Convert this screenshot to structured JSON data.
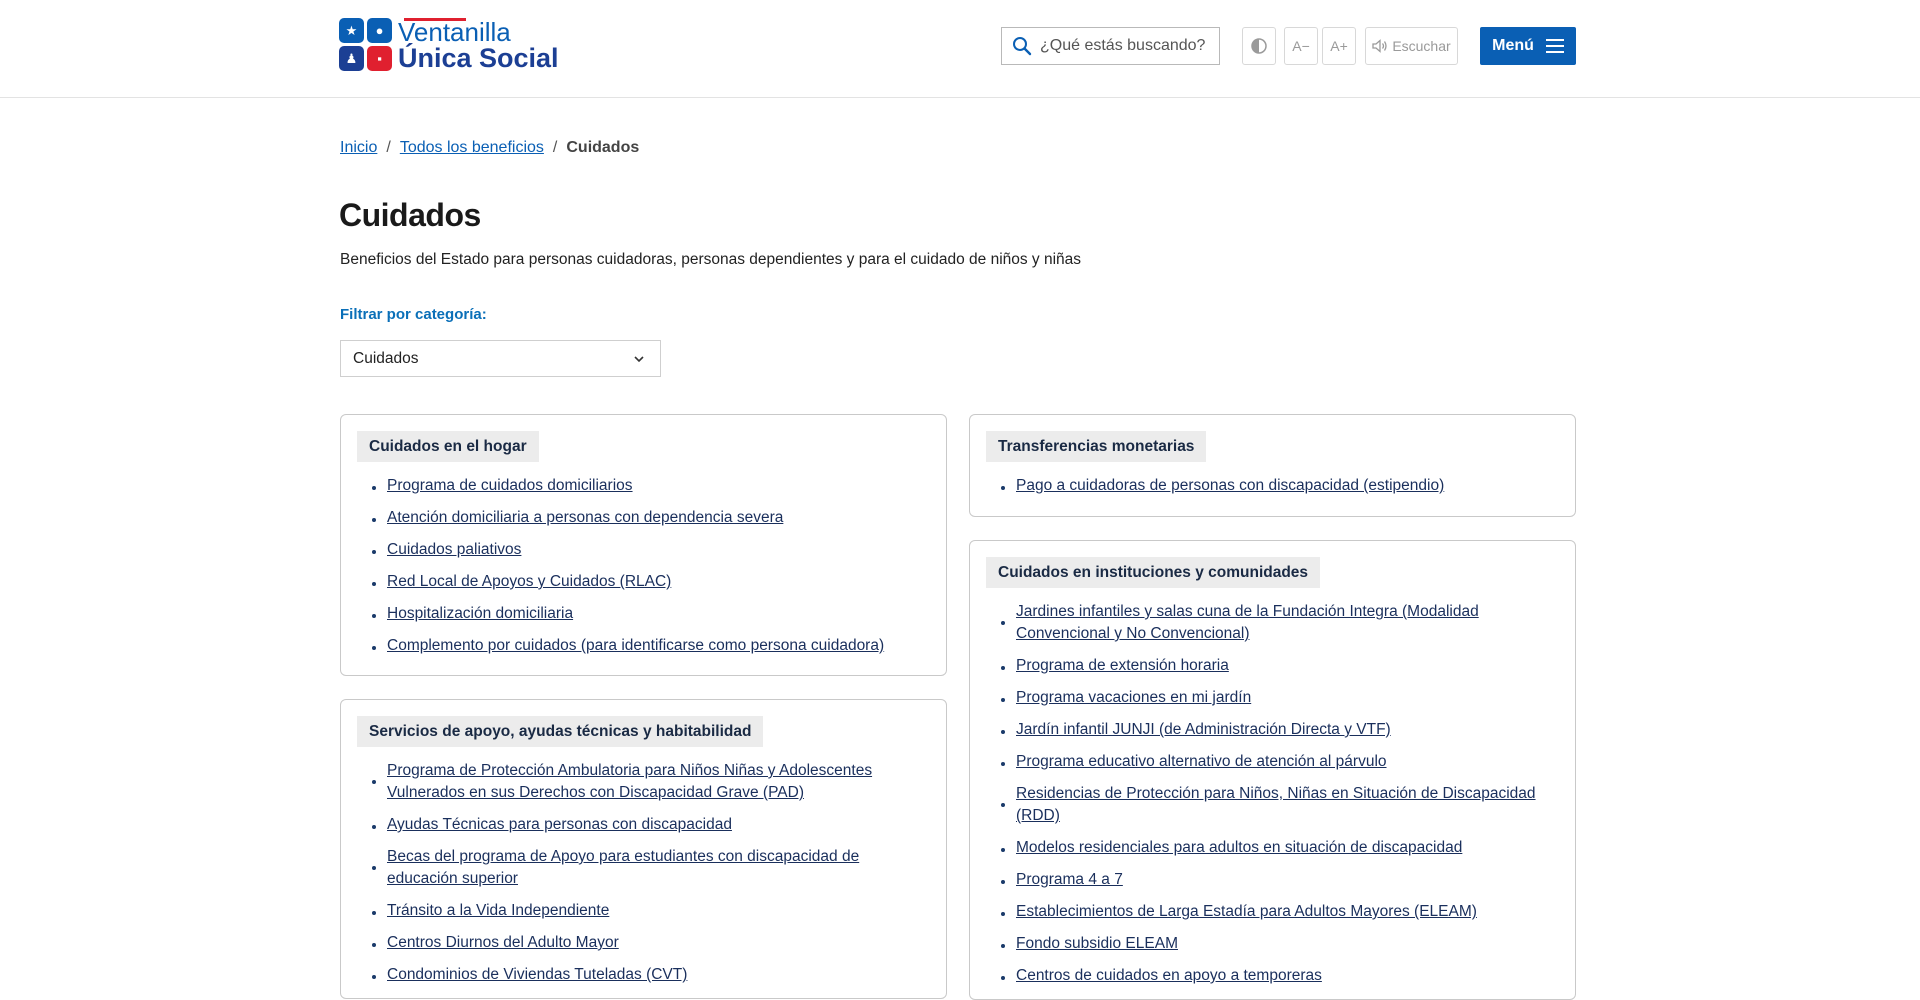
{
  "header": {
    "logo_line1": "Ventanilla",
    "logo_line2": "Única Social",
    "search_placeholder": "¿Qué estás buscando?",
    "font_minus": "A−",
    "font_plus": "A+",
    "listen_label": "Escuchar",
    "menu_label": "Menú"
  },
  "breadcrumb": {
    "home": "Inicio",
    "all": "Todos los beneficios",
    "current": "Cuidados",
    "separator": "/"
  },
  "page": {
    "title": "Cuidados",
    "description": "Beneficios del Estado para personas cuidadoras, personas dependientes y para el cuidado de niños y niñas"
  },
  "filter": {
    "label": "Filtrar por categoría:",
    "selected": "Cuidados"
  },
  "cards": {
    "hogar": {
      "title": "Cuidados en el hogar",
      "items": [
        "Programa de cuidados domiciliarios",
        "Atención domiciliaria a personas con dependencia severa",
        "Cuidados paliativos",
        "Red Local de Apoyos y Cuidados (RLAC)",
        "Hospitalización domiciliaria",
        "Complemento por cuidados (para identificarse como persona cuidadora)"
      ]
    },
    "apoyo": {
      "title": "Servicios de apoyo, ayudas técnicas y habitabilidad",
      "items": [
        "Programa de Protección Ambulatoria para Niños Niñas y Adolescentes Vulnerados en sus Derechos con Discapacidad Grave (PAD)",
        "Ayudas Técnicas para personas con discapacidad",
        "Becas del programa de Apoyo para estudiantes con discapacidad de educación superior",
        "Tránsito a la Vida Independiente",
        "Centros Diurnos del Adulto Mayor",
        "Condominios de Viviendas Tuteladas (CVT)"
      ]
    },
    "transferencias": {
      "title": "Transferencias monetarias",
      "items": [
        "Pago a cuidadoras de personas con discapacidad (estipendio)"
      ]
    },
    "instituciones": {
      "title": "Cuidados en instituciones y comunidades",
      "items": [
        "Jardines infantiles y salas cuna de la Fundación Integra (Modalidad Convencional y No Convencional)",
        "Programa de extensión horaria",
        "Programa vacaciones en mi jardín",
        "Jardín infantil JUNJI (de Administración Directa y VTF)",
        "Programa educativo alternativo de atención al párvulo",
        "Residencias de Protección para Niños, Niñas en Situación de Discapacidad (RDD)",
        "Modelos residenciales para adultos en situación de discapacidad",
        "Programa 4 a 7",
        "Establecimientos de Larga Estadía para Adultos Mayores (ELEAM)",
        "Fondo subsidio ELEAM",
        "Centros de cuidados en apoyo a temporeras"
      ]
    }
  },
  "colors": {
    "brand_blue": "#0a5fb4",
    "brand_red": "#e0202f",
    "link": "#1a2f5c"
  }
}
